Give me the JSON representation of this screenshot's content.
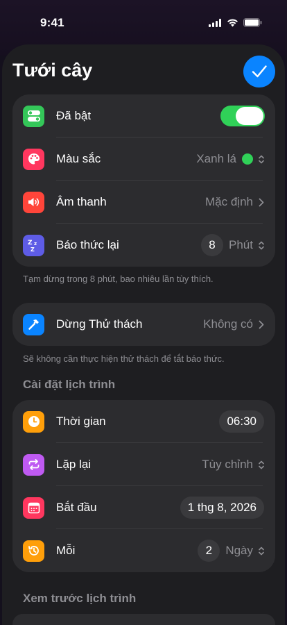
{
  "status_bar": {
    "time": "9:41"
  },
  "header": {
    "title": "Tưới cây"
  },
  "main_group": {
    "enabled_label": "Đã bật",
    "color_label": "Màu sắc",
    "color_value": "Xanh lá",
    "sound_label": "Âm thanh",
    "sound_value": "Mặc định",
    "snooze_label": "Báo thức lại",
    "snooze_amount": "8",
    "snooze_unit": "Phút"
  },
  "snooze_footnote": "Tạm dừng trong 8 phút, bao nhiêu lần tùy thích.",
  "challenge": {
    "label": "Dừng Thử thách",
    "value": "Không có"
  },
  "challenge_footnote": "Sẽ không cần thực hiện thử thách để tắt báo thức.",
  "schedule": {
    "header": "Cài đặt lịch trình",
    "time_label": "Thời gian",
    "time_value": "06:30",
    "repeat_label": "Lặp lại",
    "repeat_value": "Tùy chỉnh",
    "start_label": "Bắt đầu",
    "start_value": "1 thg 8, 2026",
    "every_label": "Mỗi",
    "every_amount": "2",
    "every_unit": "Ngày"
  },
  "preview_header": "Xem trước lịch trình",
  "colors": {
    "accent_blue": "#0a84ff",
    "toggle_green": "#30d158",
    "enabled_icon": "#34c759",
    "color_icon": "#ff375f",
    "sound_icon": "#ff453a",
    "snooze_icon": "#5e5ce6",
    "challenge_icon": "#0a84ff",
    "time_icon": "#ff9f0a",
    "repeat_icon": "#bf5af2",
    "start_icon": "#ff375f",
    "every_icon": "#ff9f0a"
  },
  "toggle_on": true
}
